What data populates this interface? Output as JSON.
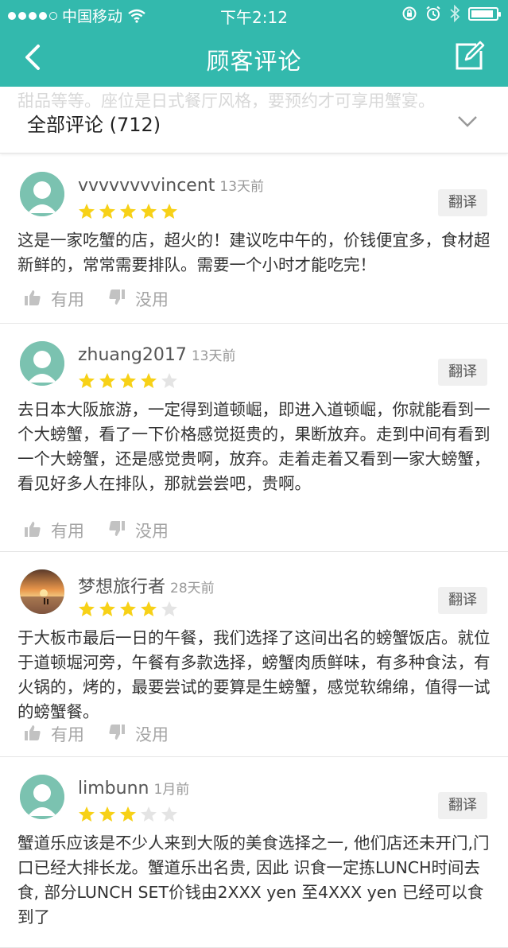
{
  "status_bar": {
    "carrier": "中国移动",
    "time": "下午2:12",
    "signal_bars": 5,
    "signal_filled": 4,
    "battery_level": 0.8
  },
  "nav": {
    "title": "顾客评论",
    "back_icon": "chevron-left-icon",
    "edit_icon": "edit-icon"
  },
  "filter": {
    "label": "全部评论 (712)",
    "ghost_text": "甜品等等。座位是日式餐厅风格，要预约才可享用蟹宴。",
    "chevron_icon": "chevron-down-icon"
  },
  "colors": {
    "accent": "#33b9ad",
    "star_on": "#f7d117",
    "star_off": "#e4e4e4"
  },
  "labels": {
    "translate": "翻译",
    "useful": "有用",
    "useless": "没用"
  },
  "reviews": [
    {
      "user": "vvvvvvvvincent",
      "ago": "13天前",
      "rating": 5,
      "avatar": "default",
      "text": "这是一家吃蟹的店，超火的！建议吃中午的，价钱便宜多，食材超新鲜的，常常需要排队。需要一个小时才能吃完！"
    },
    {
      "user": "zhuang2017",
      "ago": "13天前",
      "rating": 4,
      "avatar": "default",
      "text": "去日本大阪旅游，一定得到道顿崛，即进入道顿崛，你就能看到一个大螃蟹，看了一下价格感觉挺贵的，果断放弃。走到中间有看到一个大螃蟹，还是感觉贵啊，放弃。走着走着又看到一家大螃蟹，看见好多人在排队，那就尝尝吧，贵啊。"
    },
    {
      "user": "梦想旅行者",
      "ago": "28天前",
      "rating": 4,
      "avatar": "sunset",
      "text": "于大板市最后一日的午餐，我们选择了这间出名的螃蟹饭店。就位于道顿堀河旁，午餐有多款选择，螃蟹肉质鲜味，有多种食法，有火锅的，烤的，最要尝试的要算是生螃蟹，感觉软绵绵，值得一试的螃蟹餐。"
    },
    {
      "user": "limbunn",
      "ago": "1月前",
      "rating": 3,
      "avatar": "default",
      "text": "蟹道乐应该是不少人来到大阪的美食选择之一, 他们店还未开门,门口已经大排长龙。蟹道乐出名贵, 因此 识食一定拣LUNCH时间去食, 部分LUNCH SET价钱由2XXX yen 至4XXX yen 已经可以食到了"
    }
  ]
}
